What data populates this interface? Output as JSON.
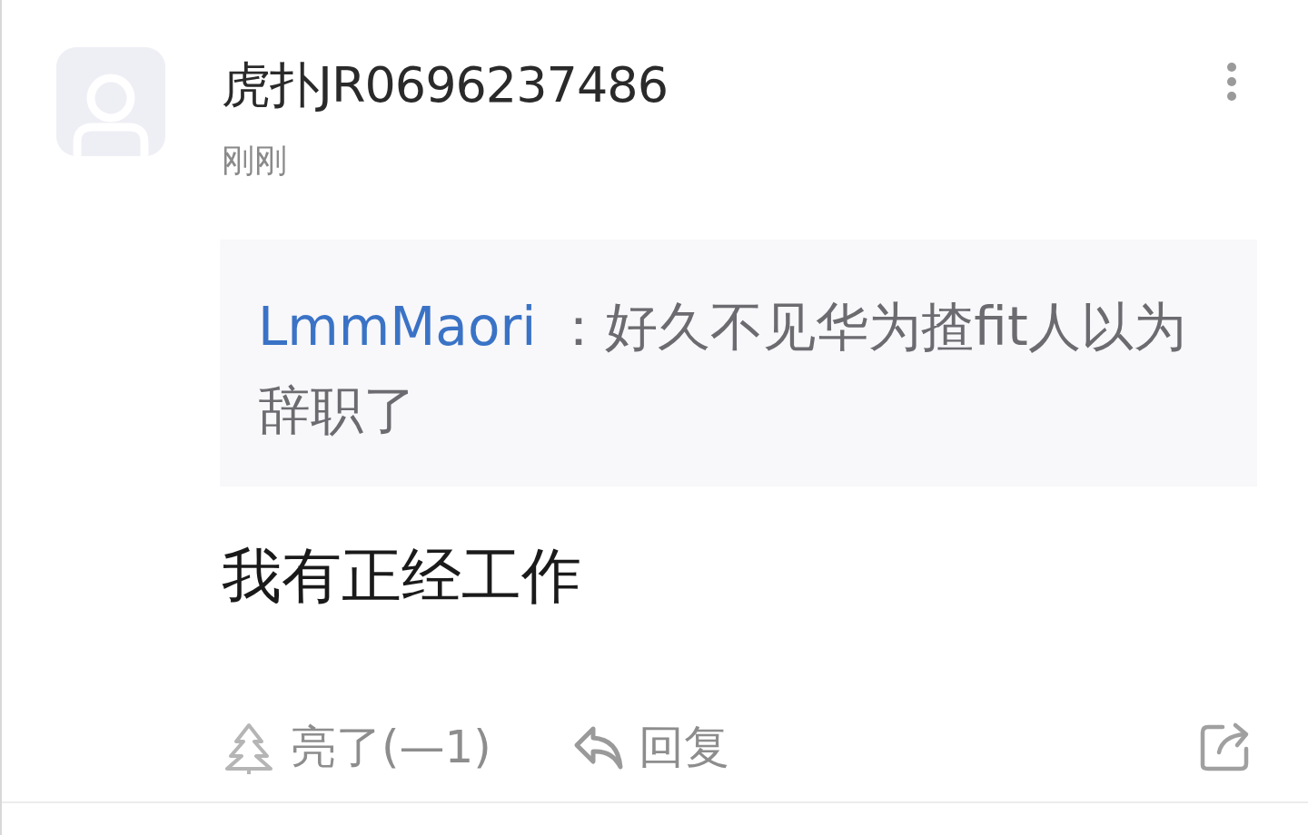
{
  "comment": {
    "username": "虎扑JR0696237486",
    "time": "刚刚",
    "quote": {
      "author": "LmmMaori",
      "text": "：好久不见华为揸fit人以为辞职了"
    },
    "body": "我有正经工作",
    "actions": [
      {
        "kind": "light",
        "label": "亮了(—1)"
      },
      {
        "kind": "reply",
        "label": "回复"
      },
      {
        "kind": "share"
      }
    ]
  }
}
